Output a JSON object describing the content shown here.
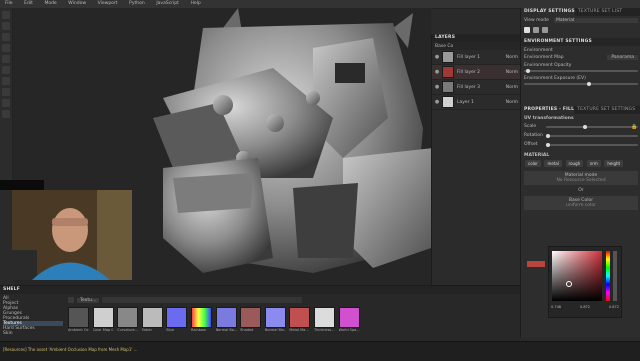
{
  "menu": [
    "File",
    "Edit",
    "Mode",
    "Window",
    "Viewport",
    "Python",
    "JavaScript",
    "Help"
  ],
  "layers": {
    "title": "LAYERS",
    "blend_label": "Base Co",
    "rows": [
      {
        "name": "Fill layer 1",
        "blend": "Norm",
        "opacity": "100"
      },
      {
        "name": "Fill layer 2",
        "blend": "Norm",
        "opacity": "100"
      },
      {
        "name": "Fill layer 3",
        "blend": "Norm",
        "opacity": "100"
      },
      {
        "name": "Layer 1",
        "blend": "Norm",
        "opacity": "100"
      }
    ]
  },
  "display": {
    "tabs": [
      "DISPLAY SETTINGS",
      "TEXTURE SET LIST"
    ],
    "view_mode_label": "View mode",
    "view_mode_value": "Material",
    "section": "ENVIRONMENT SETTINGS",
    "env_label": "Environment",
    "env_map_label": "Environment Map",
    "env_map_value": "Panorama",
    "opacity_label": "Environment Opacity",
    "exposure_label": "Environment Exposure (EV)"
  },
  "props": {
    "tabs": [
      "PROPERTIES - FILL",
      "TEXTURE SET SETTINGS"
    ],
    "uv_section": "UV transformations",
    "scale_label": "Scale",
    "rotation_label": "Rotation",
    "offset_label": "Offset",
    "material_section": "MATERIAL",
    "channel_buttons": [
      "color",
      "metal",
      "rough",
      "nrm",
      "height"
    ],
    "material_mode": "Material mode",
    "no_resource": "No Resource Selected",
    "or_label": "Or",
    "base_color": "Base Color",
    "uniform_color": "uniform color",
    "color_values": [
      "0.748",
      "0.872",
      "0.872"
    ],
    "color_values2": [
      "0.000",
      "0.000",
      "0.000"
    ],
    "colors": {
      "accent": "#b8443e",
      "picker_hue": "#d0303a"
    }
  },
  "shelf": {
    "title": "SHELF",
    "categories": [
      "All",
      "Project",
      "Alphas",
      "Grunges",
      "Procedurals",
      "Textures",
      "Hard Surfaces",
      "Skin"
    ],
    "selected_category": "Textures",
    "filter_label": "Textu...",
    "items": [
      "Ambient Oc...",
      "Color Map f...",
      "Curvature...",
      "Fabric",
      "Blue",
      "Rainbow",
      "Normal Ba...",
      "Shaded",
      "Normal Ma...",
      "Metal Ma...",
      "Thickness...",
      "World Spa..."
    ]
  },
  "status": {
    "message": "[Resources] The asset 'Ambient Occlusion Map from Mesh Map1' ..."
  },
  "webcam": {
    "caption": ""
  }
}
